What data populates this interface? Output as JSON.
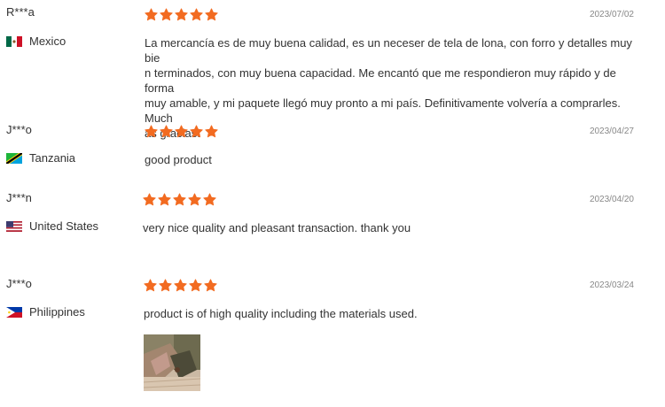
{
  "reviews": [
    {
      "reviewer": "R***a",
      "country": "Mexico",
      "flag_icon": "mexico-flag-icon",
      "rating": 5,
      "date": "2023/07/02",
      "text_lines": [
        "La mercancía es de muy buena calidad, es un neceser de tela de lona, con forro y detalles muy bie",
        "n terminados, con muy buena capacidad. Me encantó que me respondieron muy rápido y de forma",
        "muy amable, y mi paquete llegó muy pronto a mi país. Definitivamente volvería a comprarles. Much",
        "as gracias!"
      ]
    },
    {
      "reviewer": "J***o",
      "country": "Tanzania",
      "flag_icon": "tanzania-flag-icon",
      "rating": 5,
      "date": "2023/04/27",
      "text_lines": [
        "good product"
      ]
    },
    {
      "reviewer": "J***n",
      "country": "United States",
      "flag_icon": "united-states-flag-icon",
      "rating": 5,
      "date": "2023/04/20",
      "text_lines": [
        "very nice quality and pleasant transaction. thank you"
      ]
    },
    {
      "reviewer": "J***o",
      "country": "Philippines",
      "flag_icon": "philippines-flag-icon",
      "rating": 5,
      "date": "2023/03/24",
      "text_lines": [
        "product is of high quality including the materials used."
      ],
      "has_photo": true
    }
  ],
  "colors": {
    "star": "#f26b21",
    "date": "#888888",
    "text": "#333333"
  }
}
